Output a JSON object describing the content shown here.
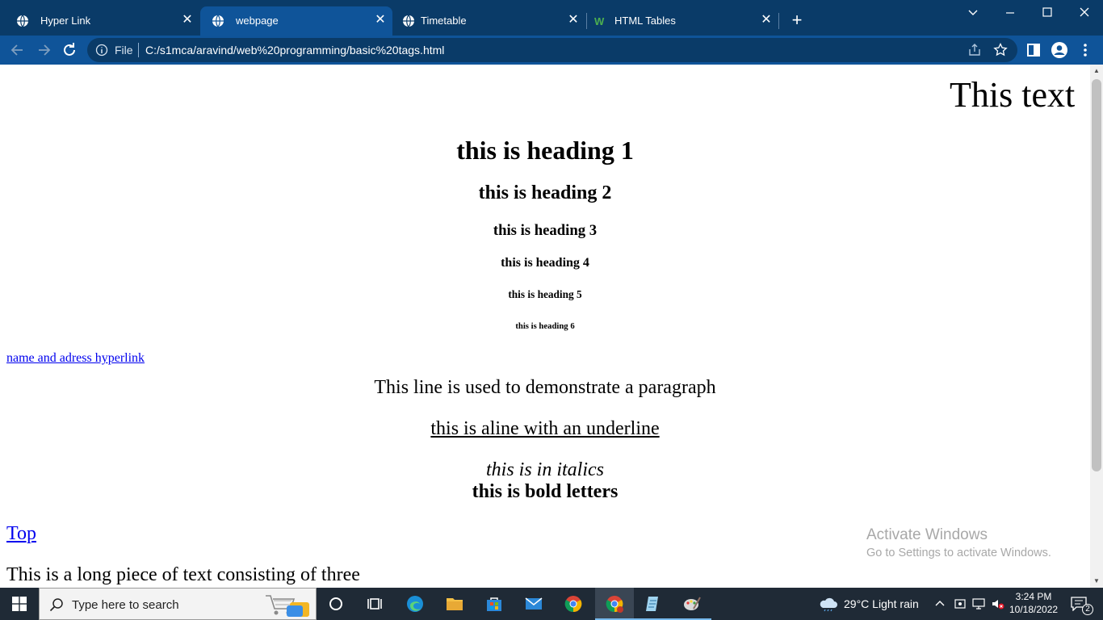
{
  "browser": {
    "tabs": [
      {
        "title": "Hyper Link",
        "active": false
      },
      {
        "title": "webpage",
        "active": true
      },
      {
        "title": "Timetable",
        "active": false
      },
      {
        "title": "HTML Tables",
        "active": false
      }
    ],
    "new_tab_symbol": "+",
    "close_symbol": "✕",
    "omnibox": {
      "security_label": "File",
      "url": "C:/s1mca/aravind/web%20programming/basic%20tags.html"
    }
  },
  "page": {
    "marquee_text": "This text",
    "headings": {
      "h1": "this is heading 1",
      "h2": "this is heading 2",
      "h3": "this is heading 3",
      "h4": "this is heading 4",
      "h5": "this is heading 5",
      "h6": "this is heading 6"
    },
    "hyperlink": "name and adress hyperlink",
    "paragraph": "This line is used to demonstrate a paragraph",
    "underline_line": "this is aline with an underline",
    "italic_line": "this is in italics",
    "bold_line": "this is bold letters",
    "top_link": "Top",
    "long_text": "This is a long piece of text consisting of three"
  },
  "watermark": {
    "line1": "Activate Windows",
    "line2": "Go to Settings to activate Windows."
  },
  "taskbar": {
    "search_placeholder": "Type here to search",
    "weather": "29°C  Light rain",
    "time": "3:24 PM",
    "date": "10/18/2022",
    "notification_count": "2"
  },
  "colors": {
    "tabstrip": "#0a3b68",
    "toolbar": "#0f5499",
    "link": "#0000ee",
    "taskbar": "#1f2a36"
  }
}
